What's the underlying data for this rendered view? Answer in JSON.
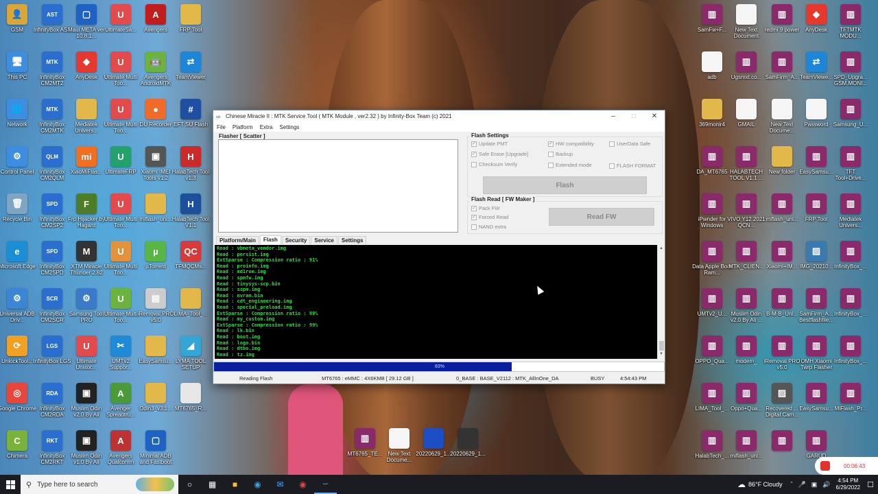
{
  "colors": {
    "accent": "#0a1f9e",
    "log_text": "#2bdc4b",
    "rec": "#e53030"
  },
  "desktop": {
    "left_icons": [
      {
        "label": "GSM",
        "icon": "folder-person-icon",
        "color": "#d9a63a",
        "glyph": "👤"
      },
      {
        "label": "InfinityBox AST",
        "icon": "infinitybox-icon",
        "color": "#2a6ecf",
        "glyph": "AST"
      },
      {
        "label": "Maui META ver 10.8.1...",
        "icon": "app-window-icon",
        "color": "#1d62c4",
        "glyph": "▢"
      },
      {
        "label": "UltimateSa...",
        "icon": "ultimate-icon",
        "color": "#e24b4b",
        "glyph": "U"
      },
      {
        "label": "Avengers",
        "icon": "avengers-icon",
        "color": "#c11d1d",
        "glyph": "A"
      },
      {
        "label": "FRP Tool",
        "icon": "folder-icon",
        "color": "#e3b84a",
        "glyph": ""
      },
      {
        "label": "This PC",
        "icon": "computer-icon",
        "color": "#3d8ee0",
        "glyph": "🖥"
      },
      {
        "label": "InfinityBox CM2MT2",
        "icon": "infinitybox-icon",
        "color": "#2a6ecf",
        "glyph": "MTK"
      },
      {
        "label": "AnyDesk",
        "icon": "anydesk-icon",
        "color": "#e5382e",
        "glyph": "◆"
      },
      {
        "label": "Ultimate Multi Too...",
        "icon": "ultimate-icon",
        "color": "#e24b4b",
        "glyph": "U"
      },
      {
        "label": "Avengers AndroidMTK",
        "icon": "android-icon",
        "color": "#6cb33e",
        "glyph": "🤖"
      },
      {
        "label": "TeamViewer",
        "icon": "teamviewer-icon",
        "color": "#1e86d9",
        "glyph": "⇄"
      },
      {
        "label": "Network",
        "icon": "network-icon",
        "color": "#3d8ee0",
        "glyph": "🌐"
      },
      {
        "label": "InfinityBox CM2MTK",
        "icon": "infinitybox-icon",
        "color": "#2a6ecf",
        "glyph": "MTK"
      },
      {
        "label": "Mediatek Univers...",
        "icon": "folder-icon",
        "color": "#e3b84a",
        "glyph": ""
      },
      {
        "label": "Ultimate Multi Too...",
        "icon": "ultimate-icon",
        "color": "#e24b4b",
        "glyph": "U"
      },
      {
        "label": "DU Recorder",
        "icon": "recorder-icon",
        "color": "#f06a2a",
        "glyph": "●"
      },
      {
        "label": "EFT SU Flash",
        "icon": "eft-icon",
        "color": "#1e4fa0",
        "glyph": "#"
      },
      {
        "label": "Control Panel",
        "icon": "control-panel-icon",
        "color": "#3d8ee0",
        "glyph": "⚙"
      },
      {
        "label": "InfinityBox CM2QLM",
        "icon": "infinitybox-icon",
        "color": "#2a6ecf",
        "glyph": "QLM"
      },
      {
        "label": "XiaoMiFlas...",
        "icon": "xiaomi-icon",
        "color": "#f26f21",
        "glyph": "mi"
      },
      {
        "label": "UltimateFRP",
        "icon": "ultimate-icon",
        "color": "#23a36b",
        "glyph": "U"
      },
      {
        "label": "Xiaomi IMEI Tools v1.2",
        "icon": "xiaomi-imei-icon",
        "color": "#555",
        "glyph": "▣"
      },
      {
        "label": "HalabTech Tool v1.3",
        "icon": "halabtech-icon",
        "color": "#c92a2a",
        "glyph": "H"
      },
      {
        "label": "Recycle Bin",
        "icon": "recycle-bin-icon",
        "color": "#7fa4c4",
        "glyph": "🗑"
      },
      {
        "label": "InfinityBox CM2SP2",
        "icon": "infinitybox-icon",
        "color": "#2a6ecf",
        "glyph": "SPD"
      },
      {
        "label": "Frp Hijacker by Hagard",
        "icon": "frp-icon",
        "color": "#4e7d2a",
        "glyph": "F"
      },
      {
        "label": "Ultimate Multi Too...",
        "icon": "ultimate-icon",
        "color": "#e24b4b",
        "glyph": "U"
      },
      {
        "label": "miflash_uni...",
        "icon": "folder-icon",
        "color": "#e3b84a",
        "glyph": ""
      },
      {
        "label": "HalabTech Tool V1.1",
        "icon": "halabtech-icon",
        "color": "#1d4f9a",
        "glyph": "H"
      },
      {
        "label": "Microsoft Edge",
        "icon": "edge-icon",
        "color": "#1a8fd6",
        "glyph": "e"
      },
      {
        "label": "InfinityBox CM2SPD",
        "icon": "infinitybox-icon",
        "color": "#2a6ecf",
        "glyph": "SPD"
      },
      {
        "label": "XTM Miracle Thunder 2.82",
        "icon": "miracle-icon",
        "color": "#333",
        "glyph": "M"
      },
      {
        "label": "Ultimate Multi Too...",
        "icon": "ultimate-icon",
        "color": "#e2923a",
        "glyph": "U"
      },
      {
        "label": "µTorrent",
        "icon": "utorrent-icon",
        "color": "#59b544",
        "glyph": "µ"
      },
      {
        "label": "TFMQCMs...",
        "icon": "tfm-icon",
        "color": "#d63a3a",
        "glyph": "QC"
      },
      {
        "label": "Universal ADB Driv...",
        "icon": "adb-driver-icon",
        "color": "#3a86d4",
        "glyph": "⚙"
      },
      {
        "label": "InfinityBox CM2SCR",
        "icon": "infinitybox-icon",
        "color": "#2a6ecf",
        "glyph": "SCR"
      },
      {
        "label": "Samsung Tool PRO",
        "icon": "samsung-tool-icon",
        "color": "#3a7ac9",
        "glyph": "⚙"
      },
      {
        "label": "Ultimate Multi Too...",
        "icon": "ultimate-icon",
        "color": "#6cb33e",
        "glyph": "U"
      },
      {
        "label": "iRemoval PRO v5.0",
        "icon": "iremoval-icon",
        "color": "#ccc",
        "glyph": "▤"
      },
      {
        "label": "LIMA_Tool_...",
        "icon": "folder-icon",
        "color": "#e3b84a",
        "glyph": ""
      },
      {
        "label": "UnlockTool...",
        "icon": "unlocktool-icon",
        "color": "#f2a024",
        "glyph": "⟳"
      },
      {
        "label": "InfinityBox LGS",
        "icon": "infinitybox-icon",
        "color": "#2a6ecf",
        "glyph": "LGS"
      },
      {
        "label": "Ultimate Unisoc...",
        "icon": "ultimate-icon",
        "color": "#e24b4b",
        "glyph": "U"
      },
      {
        "label": "UMTv2 Suppor...",
        "icon": "umt-icon",
        "color": "#1e8bd6",
        "glyph": "✂"
      },
      {
        "label": "EasySamsu...",
        "icon": "folder-icon",
        "color": "#e3b84a",
        "glyph": ""
      },
      {
        "label": "LYMA TOOL SETUP",
        "icon": "lyma-icon",
        "color": "#33a6d6",
        "glyph": "◢"
      },
      {
        "label": "Google Chrome",
        "icon": "chrome-icon",
        "color": "#e8453c",
        "glyph": "◎"
      },
      {
        "label": "InfinityBox CM2RDA",
        "icon": "infinitybox-icon",
        "color": "#2a6ecf",
        "glyph": "RDA"
      },
      {
        "label": "Muslim Odin v2.0 By Ali",
        "icon": "odin-icon",
        "color": "#222",
        "glyph": "▣"
      },
      {
        "label": "Avenger Spreadtru...",
        "icon": "avenger-icon",
        "color": "#4a9a3a",
        "glyph": "A"
      },
      {
        "label": "Odin3_v3.1...",
        "icon": "folder-icon",
        "color": "#e3b84a",
        "glyph": ""
      },
      {
        "label": "MT6765_R...",
        "icon": "file-icon",
        "color": "#e6e6e6",
        "glyph": ""
      },
      {
        "label": "Chimera",
        "icon": "chimera-icon",
        "color": "#7ab33a",
        "glyph": "C"
      },
      {
        "label": "InfinityBox CM2RKT",
        "icon": "infinitybox-icon",
        "color": "#2a6ecf",
        "glyph": "RKT"
      },
      {
        "label": "Muslim Odin v1.0 By Ali",
        "icon": "odin-icon",
        "color": "#222",
        "glyph": "▣"
      },
      {
        "label": "Avengers Qualcomm",
        "icon": "avengers-qualcomm-icon",
        "color": "#b33",
        "glyph": "A"
      },
      {
        "label": "Minimal ADB and Fastboot",
        "icon": "adb-icon",
        "color": "#1e62c4",
        "glyph": "▢"
      }
    ],
    "right_icons": [
      {
        "label": "SamFw+F...",
        "icon": "winrar-icon",
        "color": "#8b2a6a",
        "glyph": "▥"
      },
      {
        "label": "New Text Document",
        "icon": "text-file-icon",
        "color": "#f5f5f5",
        "glyph": ""
      },
      {
        "label": "redmi 9 power",
        "icon": "winrar-icon",
        "color": "#8b2a6a",
        "glyph": "▥"
      },
      {
        "label": "AnyDesk",
        "icon": "anydesk-icon",
        "color": "#e5382e",
        "glyph": "◆"
      },
      {
        "label": "TFTMTK MODU...",
        "icon": "winrar-icon",
        "color": "#8b2a6a",
        "glyph": "▥"
      },
      {
        "label": "adb",
        "icon": "file-icon",
        "color": "#f5f5f5",
        "glyph": ""
      },
      {
        "label": "Ugsmxt.co...",
        "icon": "winrar-icon",
        "color": "#8b2a6a",
        "glyph": "▥"
      },
      {
        "label": "SamFirm_A...",
        "icon": "winrar-icon",
        "color": "#8b2a6a",
        "glyph": "▥"
      },
      {
        "label": "TeamViewe...",
        "icon": "teamviewer-icon",
        "color": "#1e86d9",
        "glyph": "⇄"
      },
      {
        "label": "SPD_Upgra... GSM.MONI...",
        "icon": "winrar-icon",
        "color": "#8b2a6a",
        "glyph": "▥"
      },
      {
        "label": "369monir4",
        "icon": "folder-icon",
        "color": "#e3b84a",
        "glyph": ""
      },
      {
        "label": "GMAIL",
        "icon": "text-file-icon",
        "color": "#f5f5f5",
        "glyph": ""
      },
      {
        "label": "New Text Docume...",
        "icon": "text-file-icon",
        "color": "#f5f5f5",
        "glyph": ""
      },
      {
        "label": "Password",
        "icon": "text-file-icon",
        "color": "#f5f5f5",
        "glyph": ""
      },
      {
        "label": "Samsung_U...",
        "icon": "winrar-icon",
        "color": "#8b2a6a",
        "glyph": "▥"
      },
      {
        "label": "DA_MT6765",
        "icon": "winrar-icon",
        "color": "#8b2a6a",
        "glyph": "▥"
      },
      {
        "label": "HALABTECH TOOL V1.1 ...",
        "icon": "winrar-icon",
        "color": "#8b2a6a",
        "glyph": "▥"
      },
      {
        "label": "New folder",
        "icon": "folder-icon",
        "color": "#e3b84a",
        "glyph": ""
      },
      {
        "label": "EasySamsu...",
        "icon": "winrar-icon",
        "color": "#8b2a6a",
        "glyph": "▥"
      },
      {
        "label": "TFT Tool+Drive...",
        "icon": "winrar-icon",
        "color": "#8b2a6a",
        "glyph": "▥"
      },
      {
        "label": "iPwnder for Windows",
        "icon": "winrar-icon",
        "color": "#8b2a6a",
        "glyph": "▥"
      },
      {
        "label": "VIVO Y12 2021 QCN...",
        "icon": "winrar-icon",
        "color": "#8b2a6a",
        "glyph": "▥"
      },
      {
        "label": "miflash_unl...",
        "icon": "winrar-icon",
        "color": "#8b2a6a",
        "glyph": "▥"
      },
      {
        "label": "FRP Tool",
        "icon": "winrar-icon",
        "color": "#8b2a6a",
        "glyph": "▥"
      },
      {
        "label": "Mediatek Univers...",
        "icon": "winrar-icon",
        "color": "#8b2a6a",
        "glyph": "▥"
      },
      {
        "label": "Data Apple Boot Ram...",
        "icon": "winrar-icon",
        "color": "#8b2a6a",
        "glyph": "▥"
      },
      {
        "label": "MTK_CLIEN...",
        "icon": "winrar-icon",
        "color": "#8b2a6a",
        "glyph": "▥"
      },
      {
        "label": "Xiaomi+IM...",
        "icon": "winrar-icon",
        "color": "#8b2a6a",
        "glyph": "▥"
      },
      {
        "label": "IMG_20210...",
        "icon": "image-icon",
        "color": "#3a7ab0",
        "glyph": "▨"
      },
      {
        "label": "InfinityBox_...",
        "icon": "winrar-icon",
        "color": "#8b2a6a",
        "glyph": "▥"
      },
      {
        "label": "UMTv2_U...",
        "icon": "winrar-icon",
        "color": "#8b2a6a",
        "glyph": "▥"
      },
      {
        "label": "Muslim Odin v2.0 By Ali ...",
        "icon": "winrar-icon",
        "color": "#8b2a6a",
        "glyph": "▥"
      },
      {
        "label": "B-M-B_Unl...",
        "icon": "winrar-icon",
        "color": "#8b2a6a",
        "glyph": "▥"
      },
      {
        "label": "SamFirm_A... Bestflashfile...",
        "icon": "winrar-icon",
        "color": "#8b2a6a",
        "glyph": "▥"
      },
      {
        "label": "InfinityBox_...",
        "icon": "winrar-icon",
        "color": "#8b2a6a",
        "glyph": "▥"
      },
      {
        "label": "OPPO_Qua...",
        "icon": "winrar-icon",
        "color": "#8b2a6a",
        "glyph": "▥"
      },
      {
        "label": "modem_",
        "icon": "winrar-icon",
        "color": "#8b2a6a",
        "glyph": "▥"
      },
      {
        "label": "iRemoval PRO v5.0",
        "icon": "winrar-icon",
        "color": "#8b2a6a",
        "glyph": "▥"
      },
      {
        "label": "OMH Xiaomi Twrp Flasher",
        "icon": "winrar-icon",
        "color": "#8b2a6a",
        "glyph": "▥"
      },
      {
        "label": "InfinityBox_...",
        "icon": "winrar-icon",
        "color": "#8b2a6a",
        "glyph": "▥"
      },
      {
        "label": "LIMA_Tool_...",
        "icon": "winrar-icon",
        "color": "#8b2a6a",
        "glyph": "▥"
      },
      {
        "label": "Oppo+Qua...",
        "icon": "winrar-icon",
        "color": "#8b2a6a",
        "glyph": "▥"
      },
      {
        "label": "Recovered ... Digital Cam...",
        "icon": "image-icon",
        "color": "#555",
        "glyph": "▨"
      },
      {
        "label": "EasySamsu...",
        "icon": "winrar-icon",
        "color": "#8b2a6a",
        "glyph": "▥"
      },
      {
        "label": "MiFlash_Pr...",
        "icon": "winrar-icon",
        "color": "#8b2a6a",
        "glyph": "▥"
      },
      {
        "label": "HalabTech_...",
        "icon": "winrar-icon",
        "color": "#8b2a6a",
        "glyph": "▥"
      },
      {
        "label": "miflash_unl...",
        "icon": "winrar-icon",
        "color": "#8b2a6a",
        "glyph": "▥"
      },
      {
        "label": "",
        "icon": "winrar-icon",
        "color": "#8b2a6a",
        "glyph": "▥"
      },
      {
        "label": "GARUD",
        "icon": "winrar-icon",
        "color": "#8b2a6a",
        "glyph": "▥"
      }
    ],
    "bottom_icons": [
      {
        "label": "MT6765_TE...",
        "icon": "winrar-icon",
        "color": "#8b2a6a",
        "glyph": "▥"
      },
      {
        "label": "New Text Docume...",
        "icon": "text-file-icon",
        "color": "#f5f5f5",
        "glyph": ""
      },
      {
        "label": "20220629_1...",
        "icon": "phone-image-icon",
        "color": "#1d4fc4",
        "glyph": ""
      },
      {
        "label": "20220629_1...",
        "icon": "phone-image-icon",
        "color": "#333",
        "glyph": ""
      }
    ]
  },
  "window": {
    "title": "Chinese Miracle II : MTK Service Tool ( MTK Module , ver2.32 ) by Infinity-Box Team (c) 2021",
    "menu": [
      "File",
      "Platform",
      "Extra",
      "Settings"
    ],
    "flasher_label": "Flasher [ Scatter ]",
    "flash_settings": {
      "title": "Flash Settings",
      "col1": [
        {
          "label": "Update PMT",
          "checked": true
        },
        {
          "label": "Safe Erase [Upgrade]",
          "checked": true
        },
        {
          "label": "Checksum Verify",
          "checked": false
        }
      ],
      "col2": [
        {
          "label": "HW compatibility",
          "checked": true
        },
        {
          "label": "Backup",
          "checked": false
        },
        {
          "label": "Extended mode",
          "checked": false
        }
      ],
      "col3": [
        {
          "label": "UserData Safe",
          "checked": false
        },
        {
          "label": "FLASH FORMAT",
          "checked": false
        }
      ],
      "button": "Flash"
    },
    "flash_read": {
      "title": "Flash Read [ FW Maker ]",
      "options": [
        {
          "label": "Pack FW",
          "checked": true
        },
        {
          "label": "Forced Read",
          "checked": true
        },
        {
          "label": "NAND extra",
          "checked": false
        }
      ],
      "button": "Read FW"
    },
    "tabs": [
      {
        "label": "Platform/Main",
        "active": false
      },
      {
        "label": "Flash",
        "active": true
      },
      {
        "label": "Security",
        "active": false
      },
      {
        "label": "Service",
        "active": false
      },
      {
        "label": "Settings",
        "active": false
      }
    ],
    "log_lines": [
      "Read : vbmeta_vendor.img",
      "Read : persist.img",
      "ExtSparse : Compression ratio : 91%",
      "Read : proinfo.img",
      "Read : md1rom.img",
      "Read : spmfw.img",
      "Read : tinysys-scp.bin",
      "Read : sspm.img",
      "Read : nvram.bin",
      "Read : cdt_engineering.img",
      "Read : special_preload.img",
      "ExtSparse : Compression ratio : 99%",
      "Read : my_custom.img",
      "ExtSparse : Compression ratio : 99%",
      "Read : lk.bin",
      "Read : boot.img",
      "Read : logo.bin",
      "Read : dtbo.img",
      "Read : tz.img"
    ],
    "progress": {
      "percent": 83,
      "label": "83%"
    },
    "status": {
      "state": "Reading Flash",
      "device": "MT6765 : eMMC : 4X6KMB  [ 29.12 GB ]",
      "base": "0_BASE : BASE_V2112 : MTK_AllInOne_DA",
      "busy": "BUSY",
      "time": "4:54:43 PM"
    }
  },
  "taskbar": {
    "search_placeholder": "Type here to search",
    "weather": "86°F  Cloudy",
    "time": "4:54 PM",
    "date": "6/29/2022"
  },
  "recorder": {
    "elapsed": "00:06:43"
  }
}
